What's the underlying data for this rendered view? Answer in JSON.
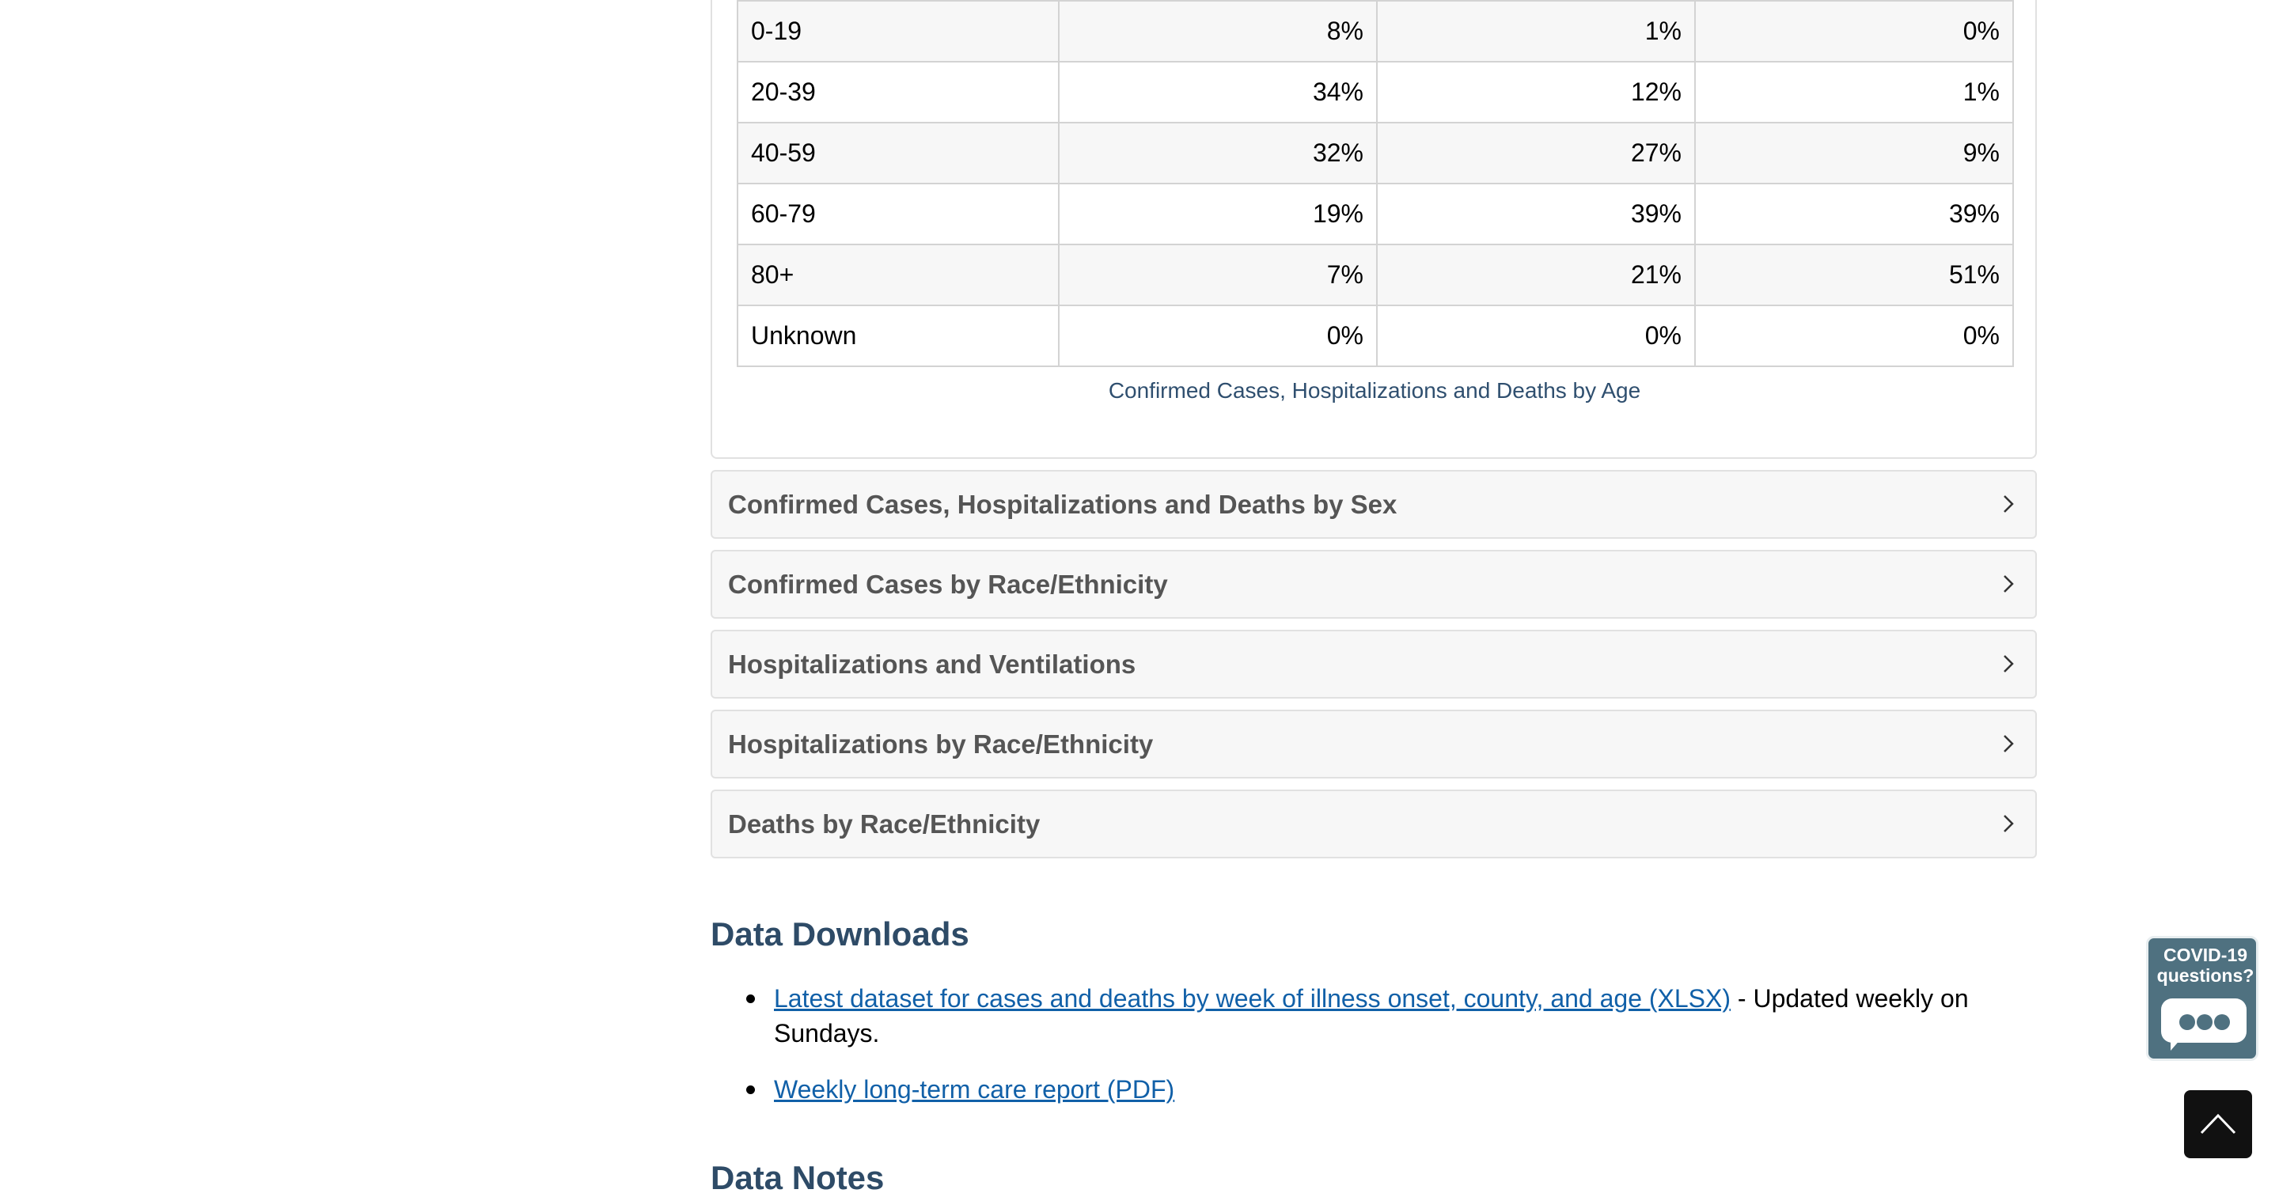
{
  "age_table": {
    "rows": [
      {
        "age": "0-19",
        "cases": "8%",
        "hospitalizations": "1%",
        "deaths": "0%"
      },
      {
        "age": "20-39",
        "cases": "34%",
        "hospitalizations": "12%",
        "deaths": "1%"
      },
      {
        "age": "40-59",
        "cases": "32%",
        "hospitalizations": "27%",
        "deaths": "9%"
      },
      {
        "age": "60-79",
        "cases": "19%",
        "hospitalizations": "39%",
        "deaths": "39%"
      },
      {
        "age": "80+",
        "cases": "7%",
        "hospitalizations": "21%",
        "deaths": "51%"
      },
      {
        "age": "Unknown",
        "cases": "0%",
        "hospitalizations": "0%",
        "deaths": "0%"
      }
    ],
    "caption": "Confirmed Cases, Hospitalizations and Deaths by Age"
  },
  "accordions": [
    {
      "title": "Confirmed Cases, Hospitalizations and Deaths by Sex",
      "icon": "chevron-right-icon"
    },
    {
      "title": "Confirmed Cases by Race/Ethnicity",
      "icon": "chevron-right-icon"
    },
    {
      "title": "Hospitalizations and Ventilations",
      "icon": "chevron-right-icon"
    },
    {
      "title": "Hospitalizations by Race/Ethnicity",
      "icon": "chevron-right-icon"
    },
    {
      "title": "Deaths by Race/Ethnicity",
      "icon": "chevron-right-icon"
    }
  ],
  "downloads": {
    "heading": "Data Downloads",
    "items": [
      {
        "link": "Latest dataset for cases and deaths by week of illness onset, county, and age (XLSX)",
        "suffix": " - Updated weekly on Sundays."
      },
      {
        "link": "Weekly long-term care report (PDF)",
        "suffix": ""
      }
    ]
  },
  "notes": {
    "heading": "Data Notes"
  },
  "widget": {
    "line1": "COVID-19",
    "line2": "questions?"
  },
  "colors": {
    "heading": "#2e4b67",
    "link": "#1160a8",
    "accordion_bg": "#f7f7f7",
    "widget_bg": "#4f7180"
  }
}
